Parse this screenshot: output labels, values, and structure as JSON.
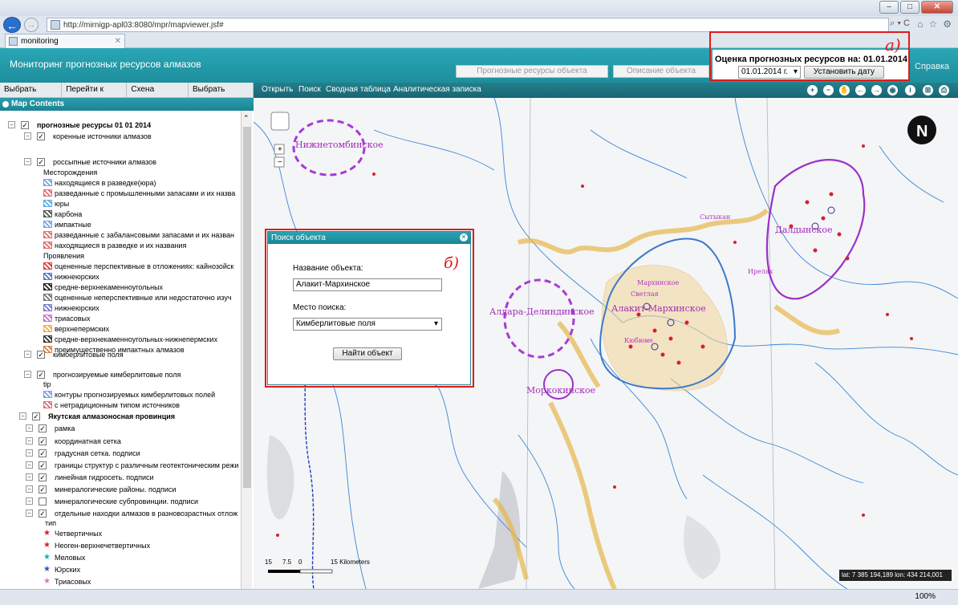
{
  "browser": {
    "url": "http://mirnigp-apl03:8080/mpr/mapviewer.jsf#",
    "tab_title": "monitoring",
    "address_tools": "⌕ ▾ C",
    "zoom": "100%"
  },
  "app": {
    "title": "Мониторинг прогнозных ресурсов алмазов",
    "header_tabs": [
      "Прогнозные ресурсы объекта",
      "Описание объекта"
    ],
    "help_link": "Справка",
    "date_title": "Оценка прогнозных ресурсов на: 01.01.2014 г.",
    "date_value": "01.01.2014 г.",
    "set_date_button": "Установить дату",
    "annotation_a": "а)",
    "annotation_b": "б)"
  },
  "left_toolbar": [
    "Выбрать район",
    "Перейти к карте",
    "Схена районов",
    "Выбрать объект"
  ],
  "map_toolbar": [
    "Открыть",
    "Поиск",
    "Сводная таблица",
    "Аналитическая записка"
  ],
  "map_contents": {
    "title": "Map Contents",
    "items": [
      {
        "text": "прогнозные ресурсы 01 01 2014",
        "bold": true
      },
      {
        "text": "коренные источники алмазов"
      },
      {
        "text": "россыпные источники алмазов"
      },
      {
        "text": "Месторождения"
      },
      {
        "text": "находящиеся в разведке(юра)"
      },
      {
        "text": "разведанные с промышленными запасами и их назва"
      },
      {
        "text": "юры"
      },
      {
        "text": "карбона"
      },
      {
        "text": "импактные"
      },
      {
        "text": "разведанные с забалансовыми запасами и их назван"
      },
      {
        "text": "находящиеся в разведке и их названия"
      },
      {
        "text": "Проявления"
      },
      {
        "text": "оцененные перспективные в отложениях: кайнозойск"
      },
      {
        "text": "нижнеюрских"
      },
      {
        "text": "средне-верхнекаменноугольных"
      },
      {
        "text": "оцененные неперспективные или недостаточно изуч"
      },
      {
        "text": "нижнеюрских"
      },
      {
        "text": "триасовых"
      },
      {
        "text": "верхнепермских"
      },
      {
        "text": "средне-верхнекаменноугольных-нижнепермских"
      },
      {
        "text": "преимущественно импактных алмазов"
      },
      {
        "text": "кимберлитовые поля"
      },
      {
        "text": "прогнозируемые кимберлитовые поля"
      },
      {
        "text": "tip"
      },
      {
        "text": "контуры прогнозируемых кимберлитовых полей"
      },
      {
        "text": "с нетрадиционным типом источников"
      },
      {
        "text": "Якутская алмазоносная провинция",
        "bold": true
      },
      {
        "text": "рамка"
      },
      {
        "text": "координатная сетка"
      },
      {
        "text": "градусная сетка. подписи"
      },
      {
        "text": "границы структур с различным геотектоническим режи"
      },
      {
        "text": "линейная гидросеть. подписи"
      },
      {
        "text": "минералогические районы. подписи"
      },
      {
        "text": "минералогические субпровинции. подписи"
      },
      {
        "text": "отдельные находки алмазов в разновозрастных отлож"
      },
      {
        "text": "тип"
      },
      {
        "text": "Четвертичных"
      },
      {
        "text": "Неоген-верхнечетвертичных"
      },
      {
        "text": "Меловых"
      },
      {
        "text": "Юрских"
      },
      {
        "text": "Триасовых"
      }
    ]
  },
  "dialog": {
    "title": "Поиск объекта",
    "name_label": "Название объекта:",
    "name_value": "Алакит-Мархинское",
    "place_label": "Место поиска:",
    "place_value": "Кимберлитовые поля",
    "find_button": "Найти объект"
  },
  "map": {
    "labels": [
      "Нижнетомбинское",
      "Алдара-Делиндинское",
      "Алакит-Мархинское",
      "Моркокинское",
      "Далдынское"
    ],
    "small_labels": [
      "Ирелях",
      "Сытыкан",
      "Мархинское",
      "Светлая",
      "Кюбюме"
    ],
    "scale_ticks": [
      "15",
      "7.5",
      "0",
      "15 Kilometers"
    ],
    "coords": "lat: 7 385 194,189 lon: 434 214,001"
  }
}
